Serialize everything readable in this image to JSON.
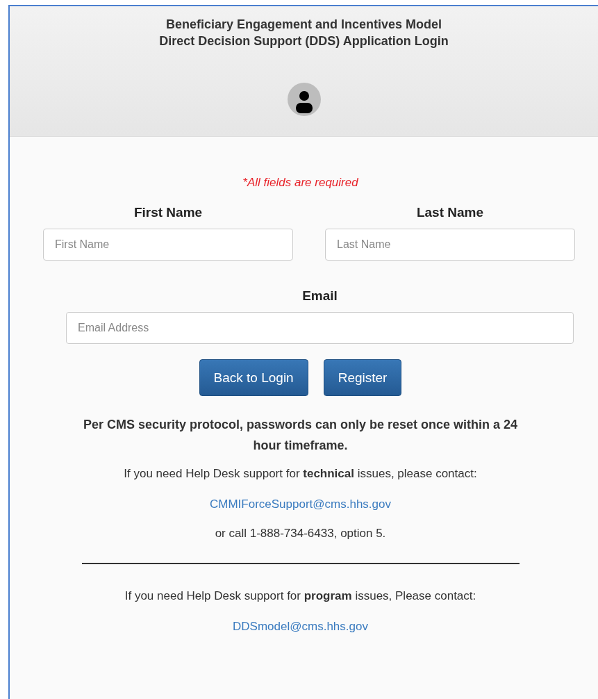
{
  "header": {
    "title_lines": [
      "Beneficiary Engagement and Incentives Model",
      "Direct Decision Support (DDS) Application Login"
    ]
  },
  "required_note": "*All fields are required",
  "name_fields": [
    {
      "label": "First Name",
      "placeholder": "First Name"
    },
    {
      "label": "Last Name",
      "placeholder": "Last Name"
    }
  ],
  "email_field": {
    "label": "Email",
    "placeholder": "Email Address"
  },
  "buttons": [
    "Back to Login",
    "Register"
  ],
  "notice": "Per CMS security protocol, passwords can only be reset once within a 24 hour timeframe.",
  "technical_help": {
    "text": "If you need Help Desk support for **technical** issues, please contact:",
    "email": "CMMIForceSupport@cms.hhs.gov",
    "phone_note": "or call 1-888-734-6433, option 5."
  },
  "program_help": {
    "text": "If you need Help Desk support for **program** issues, Please contact:",
    "email": "DDSmodel@cms.hhs.gov"
  }
}
